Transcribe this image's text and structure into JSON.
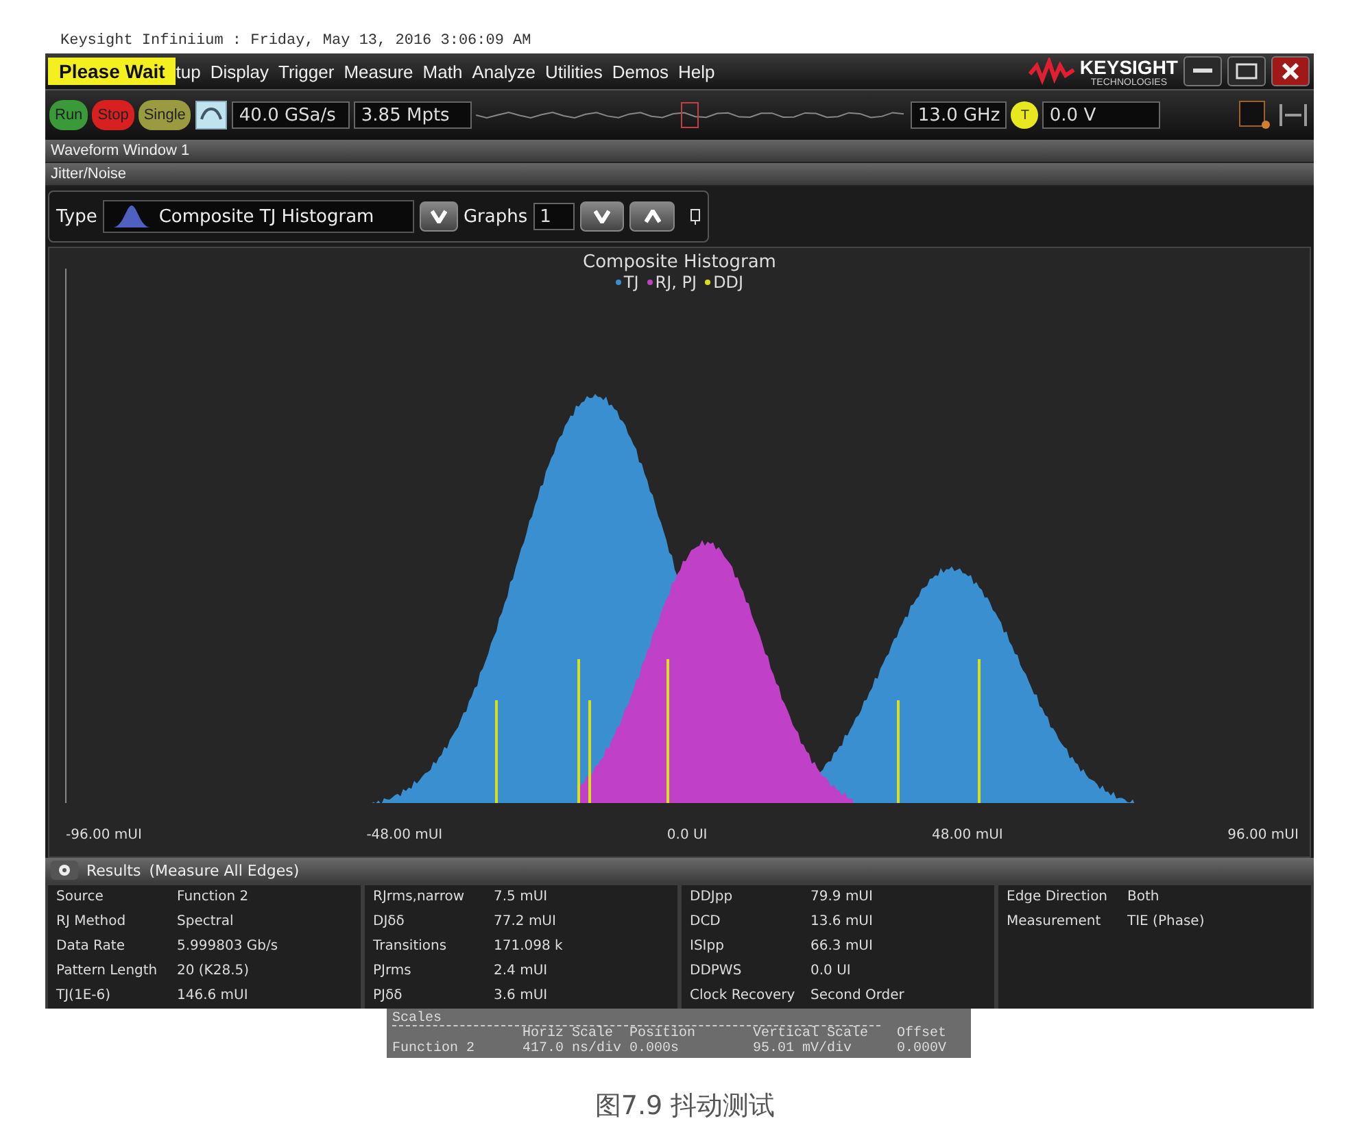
{
  "title_line": "Keysight Infiniium : Friday, May 13, 2016 3:06:09 AM",
  "menu": {
    "badge": "Please Wait",
    "items": [
      "tup",
      "Display",
      "Trigger",
      "Measure",
      "Math",
      "Analyze",
      "Utilities",
      "Demos",
      "Help"
    ]
  },
  "logo": {
    "name": "KEYSIGHT",
    "sub": "TECHNOLOGIES"
  },
  "toolbar": {
    "buttons": [
      {
        "label": "Run",
        "kind": "run"
      },
      {
        "label": "Stop",
        "kind": "stop"
      },
      {
        "label": "Single",
        "kind": "single"
      }
    ],
    "sample_rate": "40.0 GSa/s",
    "memory": "3.85 Mpts",
    "bandwidth": "13.0 GHz",
    "trigger_badge": "T",
    "trigger_level": "0.0 V"
  },
  "window_bar": "Waveform Window 1",
  "panel_bar": "Jitter/Noise",
  "type_row": {
    "type_label": "Type",
    "type_value": "Composite TJ Histogram",
    "graphs_label": "Graphs",
    "graphs_value": "1"
  },
  "chart": {
    "title": "Composite Histogram",
    "legend": [
      {
        "label": "TJ",
        "color": "#3a8fd0"
      },
      {
        "label": "RJ, PJ",
        "color": "#c040c8"
      },
      {
        "label": "DDJ",
        "color": "#d8e020"
      }
    ],
    "x_labels": [
      "-96.00 mUI",
      "-48.00 mUI",
      "0.0 UI",
      "48.00 mUI",
      "96.00 mUI"
    ]
  },
  "results": {
    "title": "Results",
    "subtitle": "(Measure All Edges)",
    "columns": [
      [
        {
          "label": "Source",
          "value": "Function 2"
        },
        {
          "label": "RJ Method",
          "value": "Spectral"
        },
        {
          "label": "Data Rate",
          "value": "5.999803 Gb/s"
        },
        {
          "label": "Pattern Length",
          "value": "20 (K28.5)"
        },
        {
          "label": "TJ(1E-6)",
          "value": "146.6 mUI"
        }
      ],
      [
        {
          "label": "RJrms,narrow",
          "value": "7.5 mUI"
        },
        {
          "label": "DJδδ",
          "value": "77.2 mUI"
        },
        {
          "label": "Transitions",
          "value": "171.098 k"
        },
        {
          "label": "PJrms",
          "value": "2.4 mUI"
        },
        {
          "label": "PJδδ",
          "value": "3.6 mUI"
        }
      ],
      [
        {
          "label": "DDJpp",
          "value": "79.9 mUI"
        },
        {
          "label": "DCD",
          "value": "13.6 mUI"
        },
        {
          "label": "ISIpp",
          "value": "66.3 mUI"
        },
        {
          "label": "DDPWS",
          "value": "0.0 UI"
        },
        {
          "label": "Clock Recovery",
          "value": "Second Order"
        }
      ],
      [
        {
          "label": "Edge Direction",
          "value": "Both"
        },
        {
          "label": "Measurement",
          "value": "TIE (Phase)"
        }
      ]
    ]
  },
  "scales": {
    "title": "Scales",
    "headers": [
      "Horiz Scale",
      "Position",
      "Vertical Scale",
      "Offset"
    ],
    "rows": [
      {
        "name": "Function 2",
        "values": [
          "417.0 ns/div",
          "0.000s",
          "95.01 mV/div",
          "0.000V"
        ]
      }
    ]
  },
  "caption": "图7.9 抖动测试"
}
